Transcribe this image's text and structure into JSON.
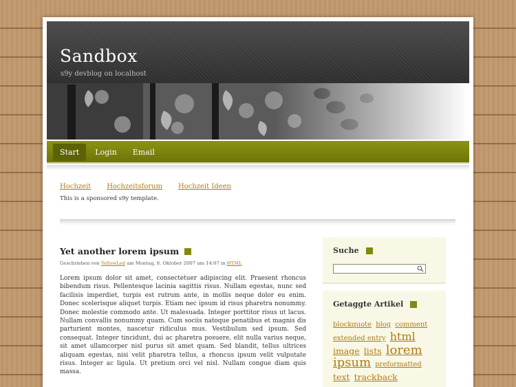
{
  "blog": {
    "title": "Sandbox",
    "tagline": "s9y devblog on localhost"
  },
  "nav": {
    "items": [
      {
        "label": "Start",
        "active": true
      },
      {
        "label": "Login",
        "active": false
      },
      {
        "label": "Email",
        "active": false
      }
    ]
  },
  "sponsor": {
    "links": [
      "Hochzeit",
      "Hochzeitsforum",
      "Hochzeit Ideen"
    ],
    "note": "This is a sponsored s9y template."
  },
  "post": {
    "title": "Yet another lorem ipsum",
    "meta_prefix": "Geschrieben von",
    "author": "YellowLed",
    "meta_date": "am Montag, 8. Oktober 2007 um 14:07 in",
    "category": "HTML",
    "body": "Lorem ipsum dolor sit amet, consectetuer adipiscing elit. Praesent rhoncus bibendum risus. Pellentesque lacinia sagittis risus. Nullam egestas, nunc sed facilisis imperdiet, turpis est rutrum ante, in mollis neque dolor eu enim. Donec scelerisque aliquet turpis. Etiam nec ipsum id risus pharetra nonummy. Donec molestie commodo ante. Ut malesuada. Integer porttitor risus ut lacus. Nullam convallis nonummy quam. Cum sociis natoque penatibus et magnis dis parturient montes, nascetur ridiculus mus. Vestibulum sed ipsum. Sed consequat. Integer tincidunt, dui ac pharetra posuere, elit nulla varius neque, sit amet ullamcorper nisl purus sit amet quam. Sed blandit, tellus ultrices aliquam egestas, nisi velit pharetra tellus, a rhoncus ipsum velit vulputate risus. Integer ac ligula. Ut pretium orci vel nisl. Nullam congue diam quis massa."
  },
  "sidebar": {
    "search": {
      "title": "Suche",
      "value": "",
      "icon": "magnifier-icon"
    },
    "tags": {
      "title": "Getaggte Artikel",
      "items": [
        {
          "label": "blockquote",
          "size": "small"
        },
        {
          "label": "blog",
          "size": "small"
        },
        {
          "label": "comment",
          "size": "small"
        },
        {
          "label": "extended entry",
          "size": "small"
        },
        {
          "label": "html",
          "size": "large"
        },
        {
          "label": "image",
          "size": "medium"
        },
        {
          "label": "lists",
          "size": "medium"
        },
        {
          "label": "lorem ipsum",
          "size": "xlarge"
        },
        {
          "label": "preformatted",
          "size": "small"
        },
        {
          "label": "text",
          "size": "medium"
        },
        {
          "label": "trackback",
          "size": "medium"
        }
      ]
    }
  },
  "colors": {
    "accent": "#7f8a10",
    "link": "#b07a12",
    "header_bg": "#3a3a3a",
    "widget_bg": "#f9f8e6"
  }
}
